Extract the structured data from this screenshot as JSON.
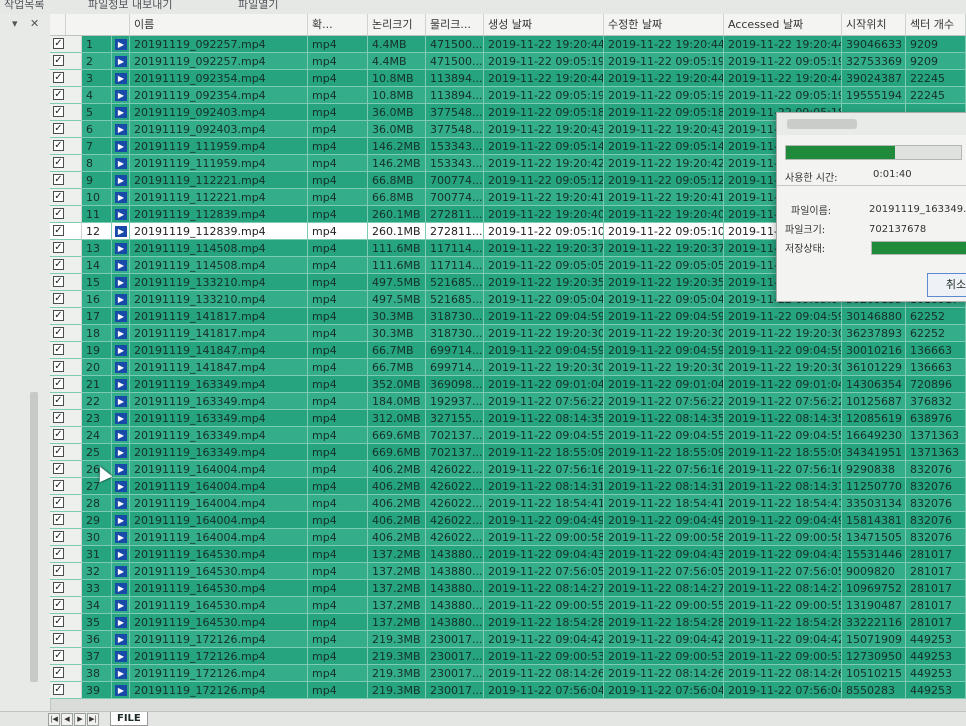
{
  "toolbar": {
    "items": [
      "작업목록",
      "파일정보 내보내기",
      "파일열기"
    ]
  },
  "side": {
    "dropdown": "▾",
    "close": "✕"
  },
  "table": {
    "columns": [
      "",
      "",
      "이름",
      "확...",
      "논리크기",
      "물리크...",
      "생성 날짜",
      "수정한 날짜",
      "Accessed 날짜",
      "시작위치",
      "섹터 개수"
    ],
    "rows": [
      [
        "1",
        "20191119_092257.mp4",
        "mp4",
        "4.4MB",
        "471500...",
        "2019-11-22 19:20:44",
        "2019-11-22 19:20:44",
        "2019-11-22 19:20:44",
        "39046633",
        "9209"
      ],
      [
        "2",
        "20191119_092257.mp4",
        "mp4",
        "4.4MB",
        "471500...",
        "2019-11-22 09:05:19",
        "2019-11-22 09:05:19",
        "2019-11-22 09:05:19",
        "32753369",
        "9209"
      ],
      [
        "3",
        "20191119_092354.mp4",
        "mp4",
        "10.8MB",
        "113894...",
        "2019-11-22 19:20:44",
        "2019-11-22 19:20:44",
        "2019-11-22 19:20:44",
        "39024387",
        "22245"
      ],
      [
        "4",
        "20191119_092354.mp4",
        "mp4",
        "10.8MB",
        "113894...",
        "2019-11-22 09:05:19",
        "2019-11-22 09:05:19",
        "2019-11-22 09:05:19",
        "19555194",
        "22245"
      ],
      [
        "5",
        "20191119_092403.mp4",
        "mp4",
        "36.0MB",
        "377548...",
        "2019-11-22 09:05:18",
        "2019-11-22 09:05:18",
        "2019-11-22 09:05:18",
        "",
        ""
      ],
      [
        "6",
        "20191119_092403.mp4",
        "mp4",
        "36.0MB",
        "377548...",
        "2019-11-22 19:20:43",
        "2019-11-22 19:20:43",
        "2019-11-22 19:20:43",
        "",
        ""
      ],
      [
        "7",
        "20191119_111959.mp4",
        "mp4",
        "146.2MB",
        "153343...",
        "2019-11-22 09:05:14",
        "2019-11-22 09:05:14",
        "2019-11-22 09:05:14",
        "",
        ""
      ],
      [
        "8",
        "20191119_111959.mp4",
        "mp4",
        "146.2MB",
        "153343...",
        "2019-11-22 19:20:42",
        "2019-11-22 19:20:42",
        "2019-11-22 19:20:42",
        "",
        ""
      ],
      [
        "9",
        "20191119_112221.mp4",
        "mp4",
        "66.8MB",
        "700774...",
        "2019-11-22 09:05:12",
        "2019-11-22 09:05:12",
        "2019-11-22 09:05:12",
        "",
        ""
      ],
      [
        "10",
        "20191119_112221.mp4",
        "mp4",
        "66.8MB",
        "700774...",
        "2019-11-22 19:20:41",
        "2019-11-22 19:20:41",
        "2019-11-22 19:20:41",
        "",
        ""
      ],
      [
        "11",
        "20191119_112839.mp4",
        "mp4",
        "260.1MB",
        "272811...",
        "2019-11-22 19:20:40",
        "2019-11-22 19:20:40",
        "2019-11-22 19:20:40",
        "",
        ""
      ],
      [
        "12",
        "20191119_112839.mp4",
        "mp4",
        "260.1MB",
        "272811...",
        "2019-11-22 09:05:10",
        "2019-11-22 09:05:10",
        "2019-11-22 09:05:10",
        "",
        ""
      ],
      [
        "13",
        "20191119_114508.mp4",
        "mp4",
        "111.6MB",
        "117114...",
        "2019-11-22 19:20:37",
        "2019-11-22 19:20:37",
        "2019-11-22 19:20:37",
        "",
        ""
      ],
      [
        "14",
        "20191119_114508.mp4",
        "mp4",
        "111.6MB",
        "117114...",
        "2019-11-22 09:05:05",
        "2019-11-22 09:05:05",
        "2019-11-22 09:05:05",
        "",
        ""
      ],
      [
        "15",
        "20191119_133210.mp4",
        "mp4",
        "497.5MB",
        "521685...",
        "2019-11-22 19:20:35",
        "2019-11-22 19:20:35",
        "2019-11-22 19:20:35",
        "",
        ""
      ],
      [
        "16",
        "20191119_133210.mp4",
        "mp4",
        "497.5MB",
        "521685...",
        "2019-11-22 09:05:04",
        "2019-11-22 09:05:04",
        "2019-11-22 09:05:04",
        "30209133",
        "1018917"
      ],
      [
        "17",
        "20191119_141817.mp4",
        "mp4",
        "30.3MB",
        "318730...",
        "2019-11-22 09:04:59",
        "2019-11-22 09:04:59",
        "2019-11-22 09:04:59",
        "30146880",
        "62252"
      ],
      [
        "18",
        "20191119_141817.mp4",
        "mp4",
        "30.3MB",
        "318730...",
        "2019-11-22 19:20:30",
        "2019-11-22 19:20:30",
        "2019-11-22 19:20:30",
        "36237893",
        "62252"
      ],
      [
        "19",
        "20191119_141847.mp4",
        "mp4",
        "66.7MB",
        "699714...",
        "2019-11-22 09:04:59",
        "2019-11-22 09:04:59",
        "2019-11-22 09:04:59",
        "30010216",
        "136663"
      ],
      [
        "20",
        "20191119_141847.mp4",
        "mp4",
        "66.7MB",
        "699714...",
        "2019-11-22 19:20:30",
        "2019-11-22 19:20:30",
        "2019-11-22 19:20:30",
        "36101229",
        "136663"
      ],
      [
        "21",
        "20191119_163349.mp4",
        "mp4",
        "352.0MB",
        "369098...",
        "2019-11-22 09:01:04",
        "2019-11-22 09:01:04",
        "2019-11-22 09:01:04",
        "14306354",
        "720896"
      ],
      [
        "22",
        "20191119_163349.mp4",
        "mp4",
        "184.0MB",
        "192937...",
        "2019-11-22 07:56:22",
        "2019-11-22 07:56:22",
        "2019-11-22 07:56:22",
        "10125687",
        "376832"
      ],
      [
        "23",
        "20191119_163349.mp4",
        "mp4",
        "312.0MB",
        "327155...",
        "2019-11-22 08:14:35",
        "2019-11-22 08:14:35",
        "2019-11-22 08:14:35",
        "12085619",
        "638976"
      ],
      [
        "24",
        "20191119_163349.mp4",
        "mp4",
        "669.6MB",
        "702137...",
        "2019-11-22 09:04:55",
        "2019-11-22 09:04:55",
        "2019-11-22 09:04:55",
        "16649230",
        "1371363"
      ],
      [
        "25",
        "20191119_163349.mp4",
        "mp4",
        "669.6MB",
        "702137...",
        "2019-11-22 18:55:09",
        "2019-11-22 18:55:09",
        "2019-11-22 18:55:09",
        "34341951",
        "1371363"
      ],
      [
        "26",
        "20191119_164004.mp4",
        "mp4",
        "406.2MB",
        "426022...",
        "2019-11-22 07:56:16",
        "2019-11-22 07:56:16",
        "2019-11-22 07:56:16",
        "9290838",
        "832076"
      ],
      [
        "27",
        "20191119_164004.mp4",
        "mp4",
        "406.2MB",
        "426022...",
        "2019-11-22 08:14:31",
        "2019-11-22 08:14:31",
        "2019-11-22 08:14:31",
        "11250770",
        "832076"
      ],
      [
        "28",
        "20191119_164004.mp4",
        "mp4",
        "406.2MB",
        "426022...",
        "2019-11-22 18:54:41",
        "2019-11-22 18:54:41",
        "2019-11-22 18:54:41",
        "33503134",
        "832076"
      ],
      [
        "29",
        "20191119_164004.mp4",
        "mp4",
        "406.2MB",
        "426022...",
        "2019-11-22 09:04:49",
        "2019-11-22 09:04:49",
        "2019-11-22 09:04:49",
        "15814381",
        "832076"
      ],
      [
        "30",
        "20191119_164004.mp4",
        "mp4",
        "406.2MB",
        "426022...",
        "2019-11-22 09:00:58",
        "2019-11-22 09:00:58",
        "2019-11-22 09:00:58",
        "13471505",
        "832076"
      ],
      [
        "31",
        "20191119_164530.mp4",
        "mp4",
        "137.2MB",
        "143880...",
        "2019-11-22 09:04:43",
        "2019-11-22 09:04:43",
        "2019-11-22 09:04:43",
        "15531446",
        "281017"
      ],
      [
        "32",
        "20191119_164530.mp4",
        "mp4",
        "137.2MB",
        "143880...",
        "2019-11-22 07:56:05",
        "2019-11-22 07:56:05",
        "2019-11-22 07:56:05",
        "9009820",
        "281017"
      ],
      [
        "33",
        "20191119_164530.mp4",
        "mp4",
        "137.2MB",
        "143880...",
        "2019-11-22 08:14:27",
        "2019-11-22 08:14:27",
        "2019-11-22 08:14:27",
        "10969752",
        "281017"
      ],
      [
        "34",
        "20191119_164530.mp4",
        "mp4",
        "137.2MB",
        "143880...",
        "2019-11-22 09:00:55",
        "2019-11-22 09:00:55",
        "2019-11-22 09:00:55",
        "13190487",
        "281017"
      ],
      [
        "35",
        "20191119_164530.mp4",
        "mp4",
        "137.2MB",
        "143880...",
        "2019-11-22 18:54:28",
        "2019-11-22 18:54:28",
        "2019-11-22 18:54:28",
        "33222116",
        "281017"
      ],
      [
        "36",
        "20191119_172126.mp4",
        "mp4",
        "219.3MB",
        "230017...",
        "2019-11-22 09:04:42",
        "2019-11-22 09:04:42",
        "2019-11-22 09:04:42",
        "15071909",
        "449253"
      ],
      [
        "37",
        "20191119_172126.mp4",
        "mp4",
        "219.3MB",
        "230017...",
        "2019-11-22 09:00:53",
        "2019-11-22 09:00:53",
        "2019-11-22 09:00:53",
        "12730950",
        "449253"
      ],
      [
        "38",
        "20191119_172126.mp4",
        "mp4",
        "219.3MB",
        "230017...",
        "2019-11-22 08:14:26",
        "2019-11-22 08:14:26",
        "2019-11-22 08:14:26",
        "10510215",
        "449253"
      ],
      [
        "39",
        "20191119_172126.mp4",
        "mp4",
        "219.3MB",
        "230017...",
        "2019-11-22 07:56:04",
        "2019-11-22 07:56:04",
        "2019-11-22 07:56:04",
        "8550283",
        "449253"
      ]
    ],
    "selected_row": 12
  },
  "bottom": {
    "sheet_tab": "FILE"
  },
  "dialog": {
    "elapsed_label": "사용한 시간:",
    "elapsed_value": "0:01:40",
    "filename_label": "파일이름:",
    "filename_value": "20191119_163349.mp4",
    "filesize_label": "파일크기:",
    "filesize_value": "702137678",
    "status_label": "저장상태:",
    "cancel_label": "취소",
    "progress": 0.62,
    "save_progress": 1.0
  },
  "colors": {
    "row": "#26a37f",
    "row_alt": "#33ad8a",
    "progress": "#1f8a3a"
  }
}
